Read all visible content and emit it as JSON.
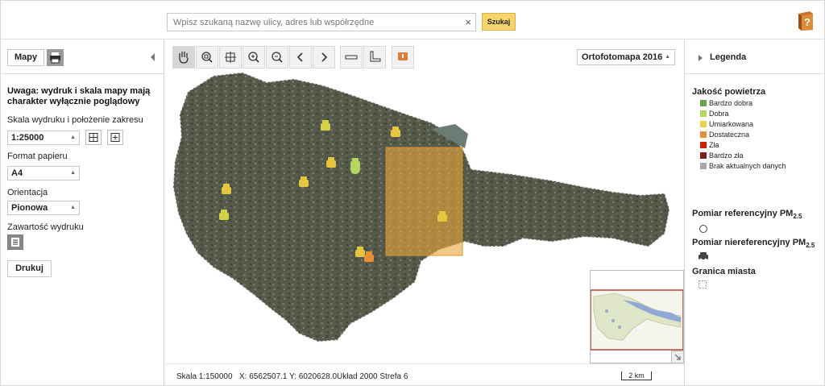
{
  "search": {
    "placeholder": "Wpisz szukaną nazwę ulicy, adres lub współrzędne",
    "clear": "×",
    "button": "Szukaj"
  },
  "left_panel": {
    "tab_maps": "Mapy",
    "warning": "Uwaga: wydruk i skala mapy mają charakter wyłącznie poglądowy",
    "scale_label": "Skala wydruku i położenie zakresu",
    "scale_value": "1:25000",
    "paper_label": "Format papieru",
    "paper_value": "A4",
    "orientation_label": "Orientacja",
    "orientation_value": "Pionowa",
    "content_label": "Zawartość wydruku",
    "print_button": "Drukuj"
  },
  "map": {
    "basemap_select": "Ortofotomapa 2016",
    "toolbar": [
      "pan-icon",
      "zoom-box-icon",
      "full-extent-icon",
      "zoom-in-icon",
      "zoom-out-icon",
      "previous-view-icon",
      "next-view-icon",
      "measure-distance-icon",
      "measure-area-icon",
      "info-icon"
    ]
  },
  "status": {
    "scale": "Skala 1:150000",
    "coords": "X: 6562507.1 Y: 6020628.0",
    "crs": "Układ 2000 Strefa 6",
    "scalebar": "2 km"
  },
  "legend": {
    "title": "Legenda",
    "air_quality_title": "Jakość powietrza",
    "air_quality_items": [
      {
        "label": "Bardzo dobra",
        "color": "#6aa84f"
      },
      {
        "label": "Dobra",
        "color": "#b6d75e"
      },
      {
        "label": "Umiarkowana",
        "color": "#ead04c"
      },
      {
        "label": "Dostateczna",
        "color": "#e69138"
      },
      {
        "label": "Zła",
        "color": "#cc2200"
      },
      {
        "label": "Bardzo zła",
        "color": "#7f1f1f"
      },
      {
        "label": "Brak aktualnych danych",
        "color": "#a8a8a8"
      }
    ],
    "reference_title": "Pomiar referencyjny PM",
    "reference_sub": "2.5",
    "nonreference_title": "Pomiar niereferencyjny PM",
    "nonreference_sub": "2.5",
    "boundary_title": "Granica miasta"
  }
}
